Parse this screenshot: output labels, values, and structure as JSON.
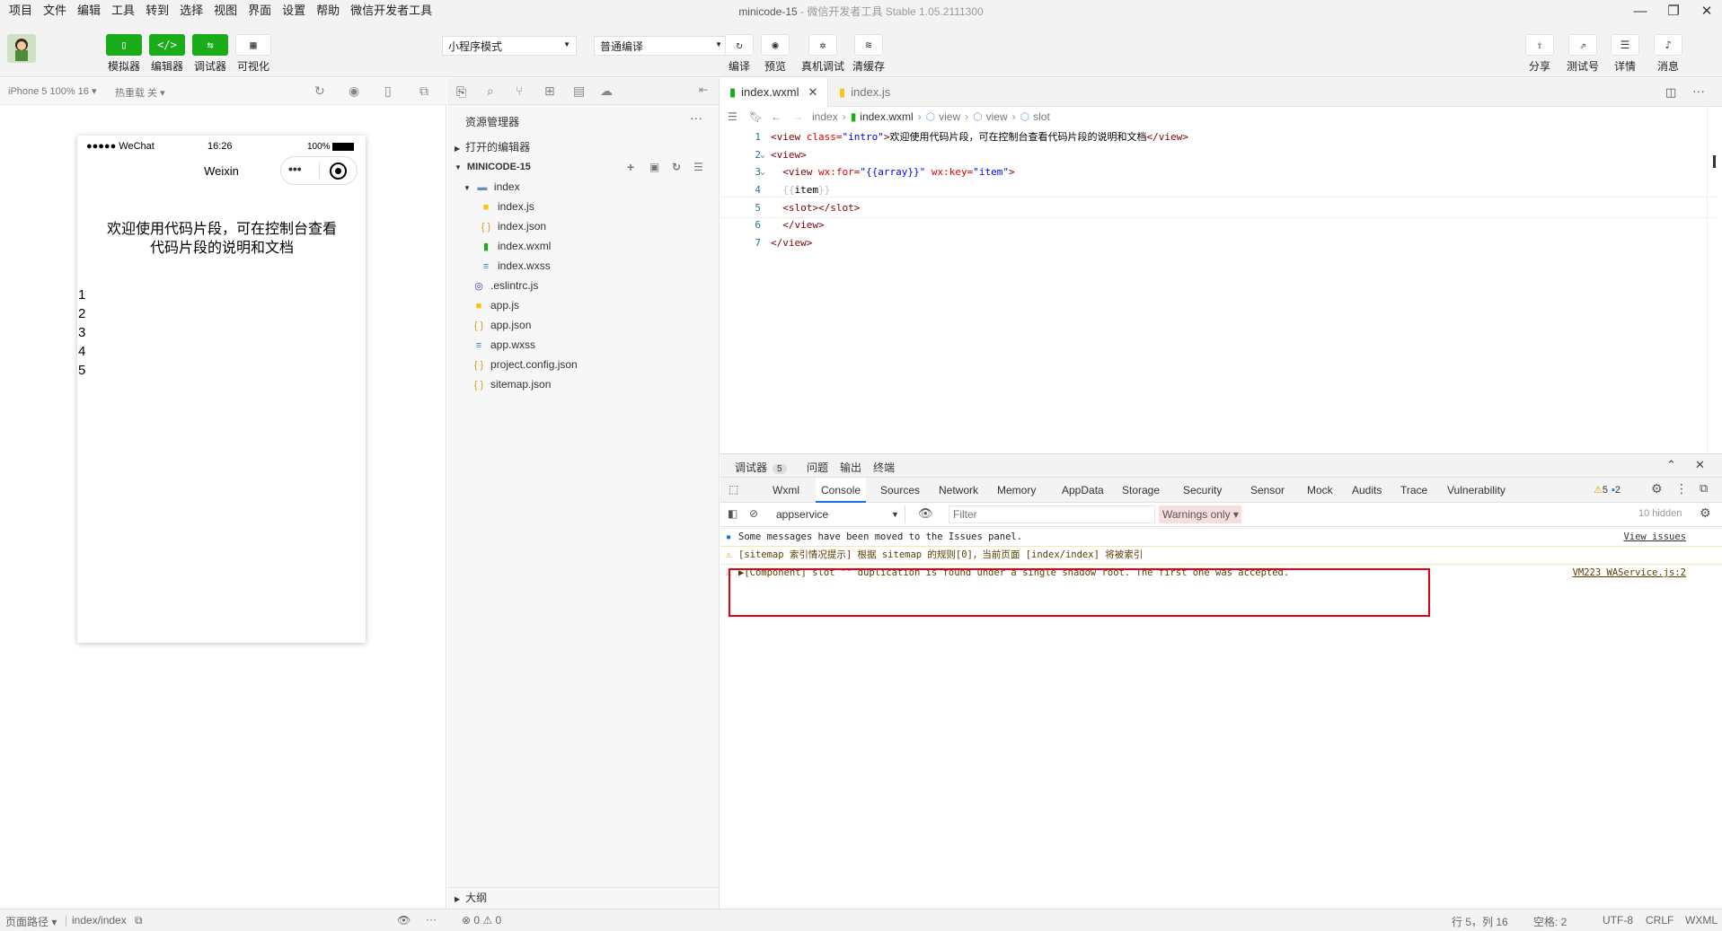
{
  "menus": [
    "项目",
    "文件",
    "编辑",
    "工具",
    "转到",
    "选择",
    "视图",
    "界面",
    "设置",
    "帮助",
    "微信开发者工具"
  ],
  "window": {
    "title": "minicode-15",
    "subtitle": "- 微信开发者工具 Stable 1.05.2111300"
  },
  "toolbar": {
    "left_buttons": [
      {
        "label": "模拟器",
        "icon": "phone-icon"
      },
      {
        "label": "编辑器",
        "icon": "code-icon"
      },
      {
        "label": "调试器",
        "icon": "debug-icon"
      },
      {
        "label": "可视化",
        "icon": "layout-icon"
      }
    ],
    "mode_select": "小程序模式",
    "compile_select": "普通编译",
    "center_buttons": [
      {
        "label": "编译",
        "icon": "refresh-icon"
      },
      {
        "label": "预览",
        "icon": "eye-icon"
      },
      {
        "label": "真机调试",
        "icon": "bug-icon"
      },
      {
        "label": "清缓存",
        "icon": "layers-icon"
      }
    ],
    "right_buttons": [
      {
        "label": "分享",
        "icon": "upload-icon"
      },
      {
        "label": "测试号",
        "icon": "external-icon"
      },
      {
        "label": "详情",
        "icon": "menu-icon"
      },
      {
        "label": "消息",
        "icon": "bell-icon"
      }
    ]
  },
  "simulator": {
    "device": "iPhone 5 100% 16",
    "hotreload": "热重载 关",
    "statusbar": {
      "signal": "●●●●● WeChat",
      "time": "16:26",
      "battery": "100%"
    },
    "nav_title": "Weixin",
    "content_text": "欢迎使用代码片段，可在控制台查看代码片段的说明和文档",
    "list": [
      "1",
      "2",
      "3",
      "4",
      "5"
    ]
  },
  "explorer": {
    "title": "资源管理器",
    "open_editors": "打开的编辑器",
    "project": "MINICODE-15",
    "tree": [
      {
        "name": "index",
        "type": "folder",
        "indent": 1
      },
      {
        "name": "index.js",
        "type": "js",
        "indent": 2
      },
      {
        "name": "index.json",
        "type": "json",
        "indent": 2
      },
      {
        "name": "index.wxml",
        "type": "wxml",
        "indent": 2
      },
      {
        "name": "index.wxss",
        "type": "wxss",
        "indent": 2
      },
      {
        "name": ".eslintrc.js",
        "type": "eslint",
        "indent": 1
      },
      {
        "name": "app.js",
        "type": "js",
        "indent": 1
      },
      {
        "name": "app.json",
        "type": "json",
        "indent": 1
      },
      {
        "name": "app.wxss",
        "type": "wxss",
        "indent": 1
      },
      {
        "name": "project.config.json",
        "type": "json",
        "indent": 1
      },
      {
        "name": "sitemap.json",
        "type": "json",
        "indent": 1
      }
    ],
    "outline": "大纲",
    "problems": {
      "errors": "0",
      "warnings": "0"
    }
  },
  "editor": {
    "tabs": [
      {
        "name": "index.wxml",
        "active": true
      },
      {
        "name": "index.js",
        "active": false
      }
    ],
    "breadcrumb": [
      "index",
      "index.wxml",
      "view",
      "view",
      "slot"
    ],
    "lines": [
      {
        "n": "1",
        "tokens": [
          [
            "tag",
            "<view "
          ],
          [
            "attr",
            "class="
          ],
          [
            "str",
            "\"intro\""
          ],
          [
            "tag",
            ">"
          ],
          [
            "txt",
            "欢迎使用代码片段，可在控制台查看代码片段的说明和文档"
          ],
          [
            "tag",
            "</view>"
          ]
        ]
      },
      {
        "n": "2",
        "tokens": [
          [
            "tag",
            "<view>"
          ]
        ]
      },
      {
        "n": "3",
        "tokens": [
          [
            "txt",
            "  "
          ],
          [
            "tag",
            "<view "
          ],
          [
            "attr",
            "wx:for="
          ],
          [
            "str",
            "\"{{array}}\""
          ],
          [
            "txt",
            " "
          ],
          [
            "attr",
            "wx:key="
          ],
          [
            "str",
            "\"item\""
          ],
          [
            "tag",
            ">"
          ]
        ]
      },
      {
        "n": "4",
        "tokens": [
          [
            "txt",
            "  "
          ],
          [
            "br",
            "{{"
          ],
          [
            "txt",
            "item"
          ],
          [
            "br",
            "}}"
          ]
        ]
      },
      {
        "n": "5",
        "tokens": [
          [
            "txt",
            "  "
          ],
          [
            "tag",
            "<slot></slot>"
          ]
        ]
      },
      {
        "n": "6",
        "tokens": [
          [
            "txt",
            "  "
          ],
          [
            "tag",
            "</view>"
          ]
        ]
      },
      {
        "n": "7",
        "tokens": [
          [
            "tag",
            "</view>"
          ]
        ]
      }
    ]
  },
  "devtools": {
    "top_tabs": [
      {
        "label": "调试器",
        "badge": "5"
      },
      {
        "label": "问题"
      },
      {
        "label": "输出"
      },
      {
        "label": "终端"
      }
    ],
    "panels": [
      "Wxml",
      "Console",
      "Sources",
      "Network",
      "Memory",
      "AppData",
      "Storage",
      "Security",
      "Sensor",
      "Mock",
      "Audits",
      "Trace",
      "Vulnerability"
    ],
    "active_panel": "Console",
    "warn_count": "5",
    "info_count": "2",
    "context": "appservice",
    "filter_placeholder": "Filter",
    "levels": "Warnings only",
    "hidden": "10 hidden",
    "messages": [
      {
        "type": "info",
        "text": "Some messages have been moved to the Issues panel.",
        "link": "View issues"
      },
      {
        "type": "warn",
        "text": "[sitemap 索引情况提示] 根据 sitemap 的规则[0]，当前页面 [index/index] 将被索引",
        "link": ""
      },
      {
        "type": "warn",
        "text": "▶[Component] slot \"\" duplication is found under a single shadow root. The first one was accepted.",
        "link": "VM223 WAService.js:2"
      }
    ]
  },
  "statusbar": {
    "page_path_label": "页面路径",
    "page_path": "index/index",
    "position": "行 5，列 16",
    "spaces": "空格: 2",
    "encoding": "UTF-8",
    "eol": "CRLF",
    "lang": "WXML"
  },
  "colors": {
    "green": "#1aad19",
    "highlight": "#e60012",
    "warn_bg": "#fffbe5"
  }
}
